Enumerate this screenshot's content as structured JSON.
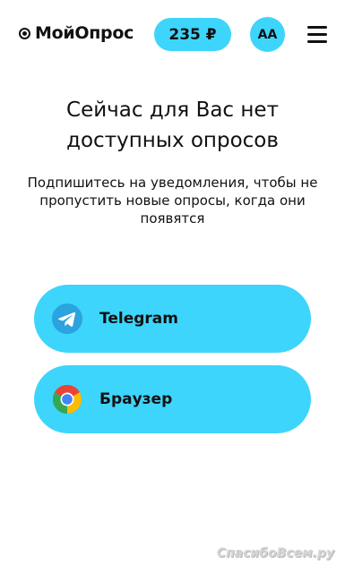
{
  "header": {
    "logo_text": "МойОпрос",
    "balance": "235 ₽",
    "avatar_initials": "АА"
  },
  "main": {
    "title_lines": [
      "Сейчас для Вас нет",
      "доступных опросов"
    ],
    "subtitle_lines": [
      "Подпишитесь на уведомления, чтобы не",
      "пропустить новые опросы, когда они",
      "появятся"
    ]
  },
  "options": [
    {
      "label": "Telegram",
      "icon": "telegram-icon"
    },
    {
      "label": "Браузер",
      "icon": "chrome-icon"
    }
  ],
  "watermark": "СпасибоВсем.ру",
  "colors": {
    "accent": "#3dd5fb",
    "text": "#111111",
    "background": "#ffffff"
  }
}
